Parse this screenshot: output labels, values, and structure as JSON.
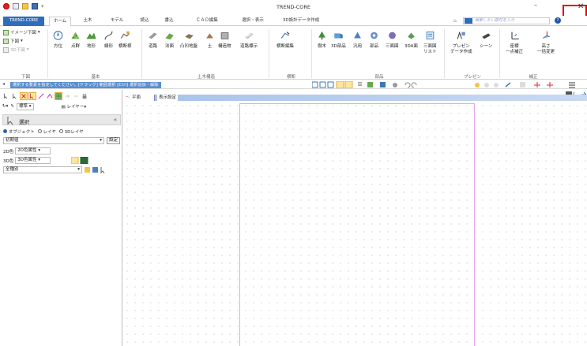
{
  "window": {
    "title": "TREND-CORE",
    "minimize": "–",
    "close": "✕"
  },
  "quick_access": {
    "dropdown": "▾"
  },
  "tabs": [
    {
      "label": "TREND-CORE"
    },
    {
      "label": "ホーム"
    },
    {
      "label": "土木"
    },
    {
      "label": "モデル"
    },
    {
      "label": "読込"
    },
    {
      "label": "書込"
    },
    {
      "label": "ＣＡＤ編集"
    },
    {
      "label": "選択・表示"
    },
    {
      "label": "3D設計データ作成"
    }
  ],
  "search": {
    "placeholder": "検索したい語句を入力"
  },
  "ribbon": {
    "left_small": {
      "image_drawing": "イメージ下図",
      "lower_drawing": "下図",
      "3d_drawing": "3D下図",
      "group": "下図"
    },
    "buttons": [
      {
        "label": "方位"
      },
      {
        "label": "点群"
      },
      {
        "label": "地形"
      },
      {
        "label": "線形"
      },
      {
        "label": "横断様"
      },
      {
        "label": "道路"
      },
      {
        "label": "法面"
      },
      {
        "label": "凸凹地盤"
      },
      {
        "label": "土"
      },
      {
        "label": "構造物"
      },
      {
        "label": "道路標示"
      },
      {
        "label": "横断編集"
      },
      {
        "label": "樹木"
      },
      {
        "label": "3D部品"
      },
      {
        "label": "汎用"
      },
      {
        "label": "部品"
      },
      {
        "label": "三面図"
      },
      {
        "label": "3DA面"
      },
      {
        "label": "三面図\nリスト"
      },
      {
        "label": "プレゼン\nデータ作成"
      },
      {
        "label": "シーン"
      },
      {
        "label": "座標\n一点補正"
      },
      {
        "label": "高さ\n一括変更"
      }
    ],
    "groups": {
      "basic": "基本",
      "civil_structure": "土木構造",
      "cross_section": "横断",
      "parts": "部品",
      "presen": "プレゼン",
      "correction": "補正"
    }
  },
  "hint": {
    "text": "選択する要素を指定してください。[ドラッグ] 範囲選択 [Ctrl] 選択追加・解除"
  },
  "left_panel": {
    "layer_button": "レイヤー",
    "standard_combo": "標準",
    "select_title": "選択",
    "radios": [
      {
        "label": "オブジェクト",
        "checked": true
      },
      {
        "label": "レイヤ",
        "checked": false
      },
      {
        "label": "3Dレイヤ",
        "checked": false
      }
    ],
    "initial_value": "初期値",
    "setting_button": "設定",
    "color_2d_label": "2D色",
    "color_2d_value": "2D色属性",
    "color_3d_label": "3D色",
    "color_3d_value": "3D色属性",
    "kind_value": "全種別"
  },
  "canvas": {
    "view_tab": "平面",
    "view_setting": "表示設定"
  },
  "colors": {
    "accent": "#2f6dbb",
    "hint_bg": "#5a8fd0",
    "frame": "#e7a6e7",
    "close_highlight": "#e00000"
  }
}
